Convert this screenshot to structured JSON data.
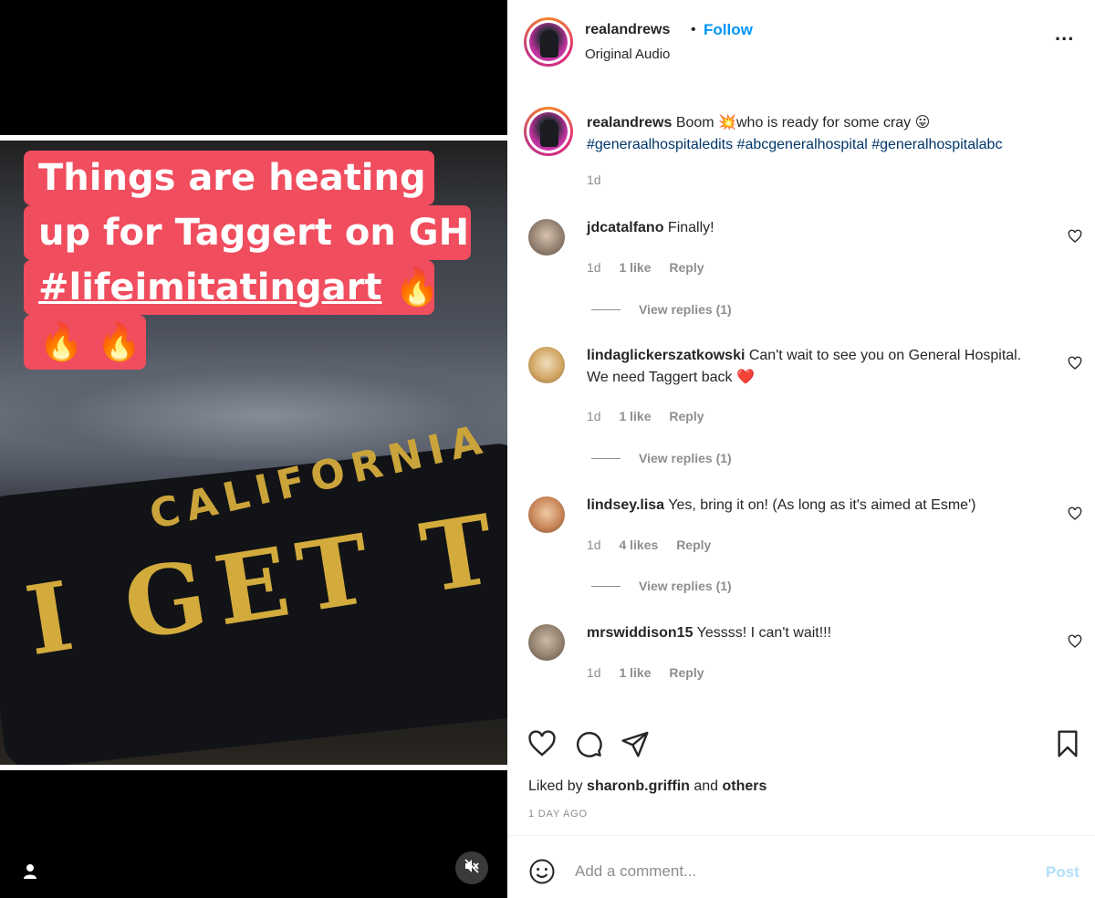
{
  "media": {
    "caption_lines": [
      "Things are heating",
      "up for Taggert on GH"
    ],
    "caption_hashtag": "#lifeimitatingart",
    "caption_emoji_1": "🔥",
    "caption_emoji_2": "🔥 🔥",
    "plate_state": "CALIFORNIA",
    "plate_text": "I GET T",
    "icons": {
      "user_tag": "user-icon",
      "mute": "muted-speaker-icon"
    }
  },
  "header": {
    "username": "realandrews",
    "separator": "•",
    "follow_label": "Follow",
    "audio": "Original Audio",
    "more": "..."
  },
  "post_caption": {
    "username": "realandrews",
    "text": " Boom 💥who is ready for some cray 😛",
    "hashtags": "#generaalhospitaledits #abcgeneralhospital #generalhospitalabc",
    "time": "1d"
  },
  "comments": [
    {
      "username": "jdcatalfano",
      "text": " Finally!",
      "time": "1d",
      "likes": "1 like",
      "reply_label": "Reply",
      "view_replies": "View replies (1)",
      "avatar_color": "#a9998c"
    },
    {
      "username": "lindaglickerszatkowski",
      "text": " Can't wait to see you on General Hospital. We need Taggert back ❤️",
      "time": "1d",
      "likes": "1 like",
      "reply_label": "Reply",
      "view_replies": "View replies (1)",
      "avatar_color": "#d9b06a"
    },
    {
      "username": "lindsey.lisa",
      "text": " Yes, bring it on! (As long as it's aimed at Esme')",
      "time": "1d",
      "likes": "4 likes",
      "reply_label": "Reply",
      "view_replies": "View replies (1)",
      "avatar_color": "#c98e63"
    },
    {
      "username": "mrswiddison15",
      "text": " Yessss! I can't wait!!!",
      "time": "1d",
      "likes": "1 like",
      "reply_label": "Reply",
      "avatar_color": "#9a8a76"
    }
  ],
  "likes": {
    "prefix": "Liked by ",
    "user": "sharonb.griffin",
    "middle": " and ",
    "others": "others"
  },
  "posted_ago": "1 DAY AGO",
  "add_comment": {
    "placeholder": "Add a comment...",
    "post_label": "Post"
  },
  "colors": {
    "follow": "#0095f6",
    "hashtag": "#00376b",
    "caption_bg": "#f04d5e",
    "heart_emoji": "#e0245e",
    "post_disabled": "#b2dffc"
  }
}
